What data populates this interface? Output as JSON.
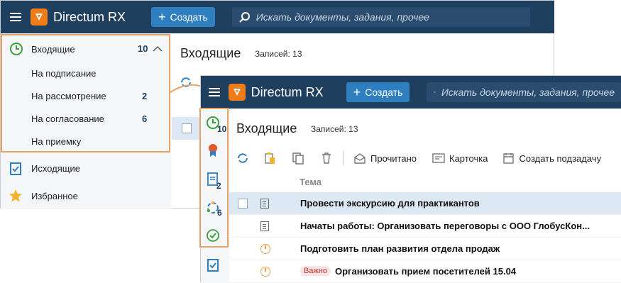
{
  "back_window": {
    "app_title": "Directum RX",
    "create_label": "Создать",
    "search_placeholder": "Искать документы, задания, прочее",
    "page_title": "Входящие",
    "records_label": "Записей: 13",
    "sidebar": {
      "incoming": {
        "label": "Входящие",
        "count": "10"
      },
      "sub_items": [
        {
          "label": "На подписание",
          "count": ""
        },
        {
          "label": "На рассмотрение",
          "count": "2"
        },
        {
          "label": "На согласование",
          "count": "6"
        },
        {
          "label": "На приемку",
          "count": ""
        }
      ],
      "outgoing": {
        "label": "Исходящие"
      },
      "favorites": {
        "label": "Избранное"
      }
    }
  },
  "front_window": {
    "app_title": "Directum RX",
    "create_label": "Создать",
    "search_placeholder": "Искать документы, задания, прочее",
    "page_title": "Входящие",
    "records_label": "Записей: 13",
    "rail_counts": {
      "incoming": "10",
      "review": "2",
      "approval": "6"
    },
    "toolbar": {
      "read_label": "Прочитано",
      "card_label": "Карточка",
      "subtask_label": "Создать подзадачу"
    },
    "column_subject": "Тема",
    "rows": [
      {
        "subject": "Провести экскурсию для практикантов",
        "badge": ""
      },
      {
        "subject": "Начаты работы: Организовать переговоры с ООО ГлобусКон...",
        "badge": ""
      },
      {
        "subject": "Подготовить план развития отдела продаж",
        "badge": ""
      },
      {
        "subject": "Организовать прием посетителей 15.04",
        "badge": "Важно"
      }
    ]
  },
  "colors": {
    "accent_orange": "#f07c19",
    "header": "#1f3f5f",
    "highlight": "#e7a266",
    "selected_row": "#dce9f5"
  }
}
